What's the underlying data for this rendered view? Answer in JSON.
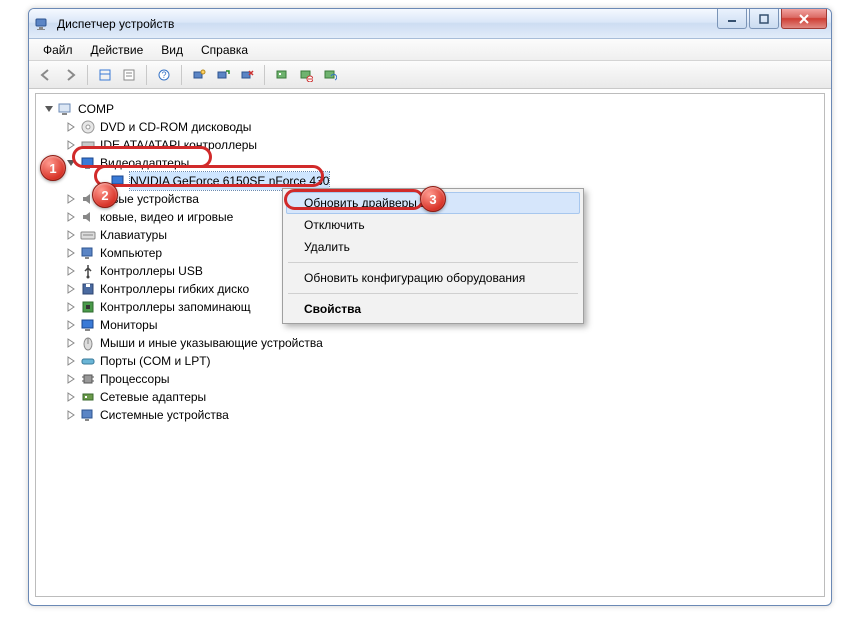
{
  "window": {
    "title": "Диспетчер устройств"
  },
  "menubar": {
    "file": "Файл",
    "action": "Действие",
    "view": "Вид",
    "help": "Справка"
  },
  "tree": {
    "root": "COMP",
    "items": [
      "DVD и CD-ROM дисководы",
      "IDE ATA/ATAPI контроллеры",
      "Видеоадаптеры",
      "NVIDIA GeForce 6150SE nForce 430",
      "ковые устройства",
      "ковые, видео и игровые",
      "Клавиатуры",
      "Компьютер",
      "Контроллеры USB",
      "Контроллеры гибких диско",
      "Контроллеры запоминающ",
      "Мониторы",
      "Мыши и иные указывающие устройства",
      "Порты (COM и LPT)",
      "Процессоры",
      "Сетевые адаптеры",
      "Системные устройства"
    ]
  },
  "context_menu": {
    "update_drivers": "Обновить драйверы...",
    "disable": "Отключить",
    "delete": "Удалить",
    "scan_hw": "Обновить конфигурацию оборудования",
    "properties": "Свойства"
  },
  "badges": {
    "b1": "1",
    "b2": "2",
    "b3": "3"
  }
}
